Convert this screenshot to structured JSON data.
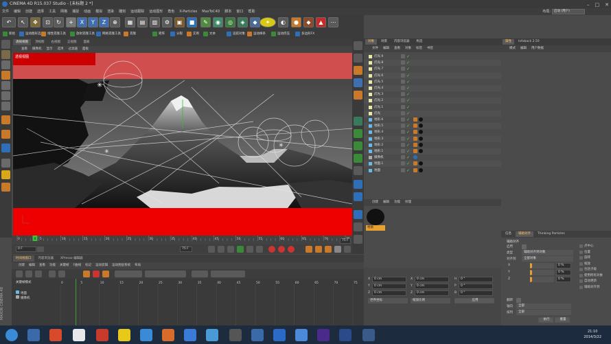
{
  "title": "CINEMA 4D R15.037 Studio - [未标题 2 *]",
  "menus": [
    "文件",
    "编辑",
    "创建",
    "选择",
    "工具",
    "网格",
    "捕捉",
    "动画",
    "模拟",
    "渲染",
    "雕刻",
    "运动跟踪",
    "运动图形",
    "角色",
    "X-Particles",
    "MaxToC4D",
    "脚本",
    "窗口",
    "帮助"
  ],
  "layout_label": "布局:",
  "layout_value": "启动 (用户)",
  "toolbar2": [
    "新组",
    "运动图形选集",
    "线性克隆工具",
    "放射克隆工具",
    "网格克隆工具",
    "克隆",
    "矩阵",
    "分裂",
    "实例",
    "文本",
    "追踪对象",
    "运动样条",
    "运动挤压",
    "多边形FX"
  ],
  "viewport": {
    "tabs": [
      "透视视图",
      "顶视图",
      "右视图",
      "正视图",
      "面板"
    ],
    "submenu": [
      "查看",
      "摄像机",
      "显示",
      "选项",
      "过滤器",
      "面板"
    ],
    "label": "透视视图"
  },
  "timeline": {
    "ticks": [
      "0",
      "5",
      "10",
      "15",
      "20",
      "25",
      "30",
      "35",
      "40",
      "45",
      "50",
      "55",
      "60",
      "65",
      "70",
      "75"
    ],
    "start": "0 F",
    "end": "75 F",
    "current": "4 F",
    "frame_end": "75 F",
    "current_marker": "4"
  },
  "dope": {
    "tabs": [
      "时间线窗口",
      "内容浏览器",
      "XPresso 编辑器"
    ],
    "menu": [
      "创建",
      "编辑",
      "查看",
      "功能",
      "关键帧",
      "F曲线",
      "标记",
      "运动剪辑",
      "运动图层系统",
      "布局"
    ],
    "mode": "关键帧模式",
    "rows": [
      "地面",
      "摄像机"
    ],
    "ticks": [
      "0",
      "5",
      "10",
      "15",
      "20",
      "25",
      "30",
      "35",
      "40",
      "45",
      "50",
      "55",
      "60",
      "65",
      "70",
      "75"
    ]
  },
  "objects": {
    "tabs": [
      "对象",
      "场景",
      "内容浏览器",
      "构造"
    ],
    "menu": [
      "文件",
      "编辑",
      "查看",
      "对象",
      "标签",
      "书签"
    ],
    "rows": [
      "灯光.9",
      "灯光.8",
      "灯光.7",
      "灯光.6",
      "灯光.5",
      "灯光.4",
      "灯光.3",
      "灯光.2",
      "灯光.1",
      "灯光",
      "地形.6",
      "地形.5",
      "地形.4",
      "地形.3",
      "地形.2",
      "地形.1",
      "摄像机",
      "地面.1",
      "地面"
    ]
  },
  "material": {
    "menu": [
      "创建",
      "编辑",
      "功能",
      "纹理"
    ],
    "name": "材质"
  },
  "coords": {
    "rows": [
      {
        "a": "X",
        "av": "0 cm",
        "b": "X",
        "bv": "0 cm",
        "c": "H",
        "cv": "0 °"
      },
      {
        "a": "Y",
        "av": "0 cm",
        "b": "Y",
        "bv": "0 cm",
        "c": "P",
        "cv": "0 °"
      },
      {
        "a": "Z",
        "av": "0 cm",
        "b": "Z",
        "bv": "0 cm",
        "c": "B",
        "cv": "0 °"
      }
    ],
    "world": "世界坐标",
    "scale": "缩放比例",
    "apply": "应用"
  },
  "attributes": {
    "tabs": [
      "属性",
      "Infoback 2.50"
    ],
    "menu": [
      "模式",
      "编辑",
      "用户数据"
    ],
    "subtabs": [
      "信息",
      "辅助对齐",
      "Thinking Particles"
    ],
    "section": "辅助对齐",
    "rows": [
      {
        "label": "启用",
        "value": ""
      },
      {
        "label": "类型",
        "value": "辅助对齐到对象"
      },
      {
        "label": "对齐到",
        "value": "全部对象"
      }
    ],
    "xyz": [
      {
        "axis": "X",
        "val": "0 %"
      },
      {
        "axis": "Y",
        "val": "0 %"
      },
      {
        "axis": "Z",
        "val": "0 %"
      }
    ],
    "checks": [
      "点中心",
      "位置",
      "旋转",
      "缩放",
      "包括子级",
      "使用所有对象",
      "自动更新",
      "辅助对齐到"
    ],
    "bottom_rows": [
      {
        "label": "翻转",
        "value": ""
      },
      {
        "label": "轴向",
        "value": "全部"
      },
      {
        "label": "排列",
        "value": "全部"
      }
    ],
    "buttons": [
      "执行",
      "重置"
    ]
  },
  "brand": "MAXON CINEMA 4D",
  "taskbar": {
    "time": "21:10",
    "date": "2014/3/22"
  }
}
